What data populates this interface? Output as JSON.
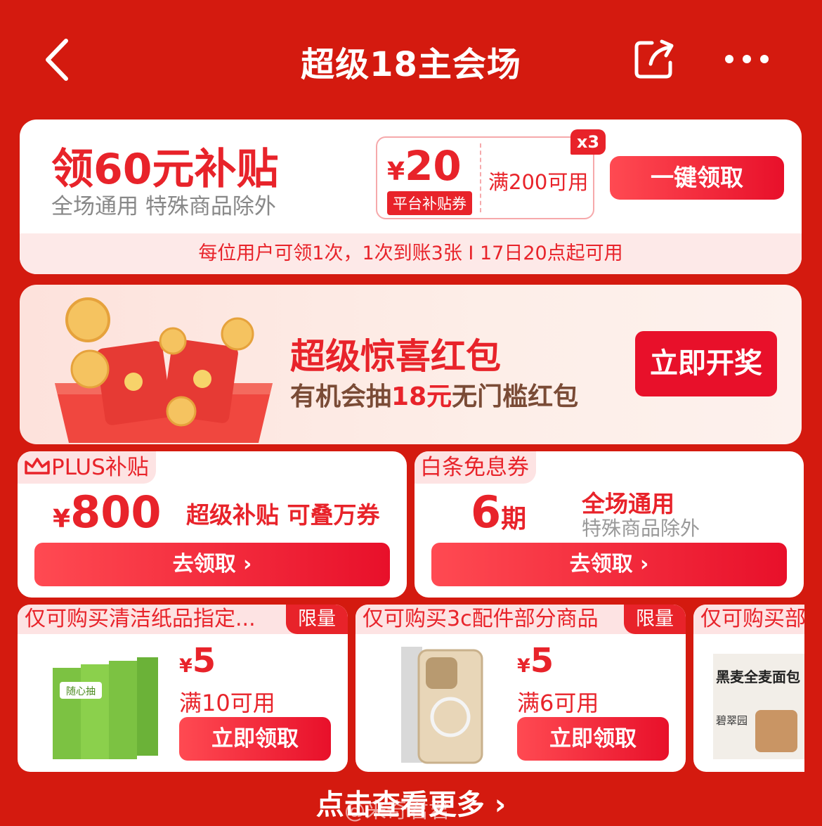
{
  "header": {
    "title": "超级18主会场"
  },
  "subsidy_card": {
    "title": "领60元补贴",
    "subtitle": "全场通用 特殊商品除外",
    "coupon_currency": "¥",
    "coupon_amount": "20",
    "coupon_tag": "平台补贴券",
    "coupon_condition": "满200可用",
    "multiplier": "x3",
    "button": "一键领取",
    "footer": "每位用户可领1次，1次到账3张 I 17日20点起可用"
  },
  "red_packet": {
    "title": "超级惊喜红包",
    "subtitle_prefix": "有机会抽",
    "subtitle_highlight": "18元",
    "subtitle_suffix": "无门槛红包",
    "button": "立即开奖"
  },
  "plus_card": {
    "tab": "PLUS补贴",
    "currency": "¥",
    "amount": "800",
    "description": "超级补贴 可叠万券",
    "button": "去领取 ›"
  },
  "baitiao_card": {
    "tab": "白条免息券",
    "amount": "6",
    "unit": "期",
    "line1": "全场通用",
    "line2": "特殊商品除外",
    "button": "去领取 ›"
  },
  "coupons": [
    {
      "title": "仅可购买清洁纸品指定...",
      "badge": "限量",
      "currency": "¥",
      "amount": "5",
      "condition": "满10可用",
      "button": "立即领取",
      "product_text": "随心抽"
    },
    {
      "title": "仅可购买3c配件部分商品",
      "badge": "限量",
      "currency": "¥",
      "amount": "5",
      "condition": "满6可用",
      "button": "立即领取"
    },
    {
      "title": "仅可购买部",
      "product_text": "黑麦全麦面包",
      "brand_text": "碧翠园"
    }
  ],
  "footer": {
    "more_link": "点击查看更多 ›",
    "watermark": "@来奇君君"
  },
  "colors": {
    "background": "#d41a0f",
    "accent": "#e8232a"
  }
}
